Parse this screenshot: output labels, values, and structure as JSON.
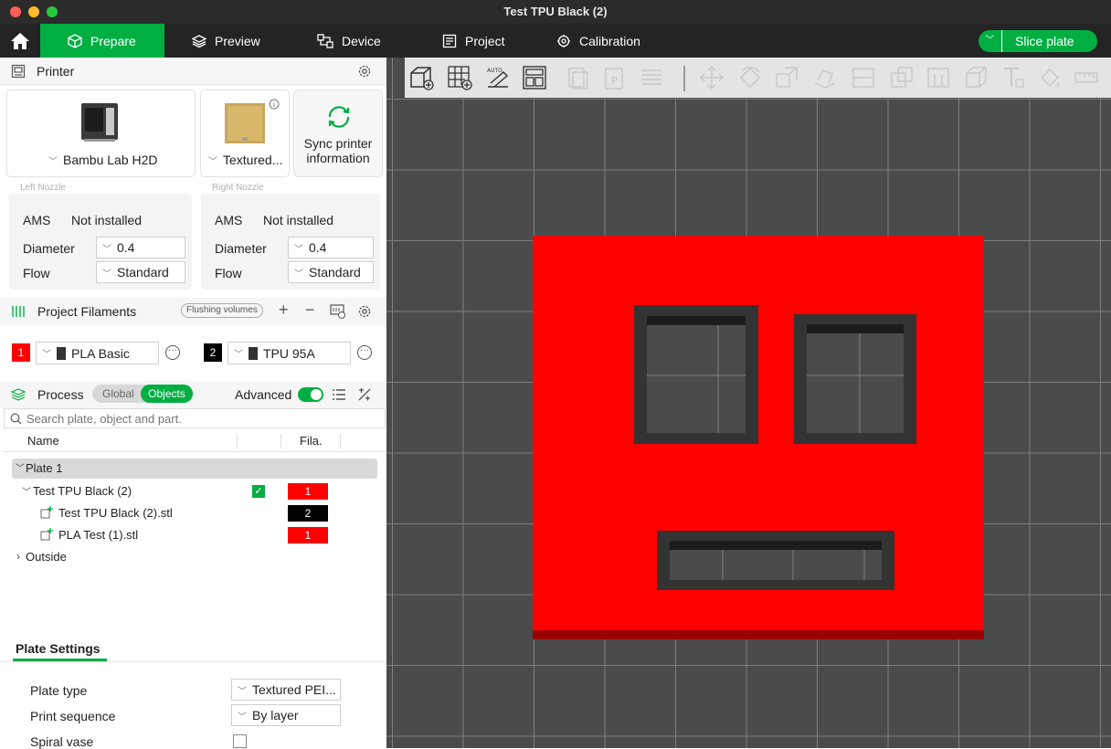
{
  "window": {
    "title": "Test TPU Black (2)"
  },
  "tabs": [
    {
      "label": "Prepare"
    },
    {
      "label": "Preview"
    },
    {
      "label": "Device"
    },
    {
      "label": "Project"
    },
    {
      "label": "Calibration"
    }
  ],
  "slice_button": {
    "label": "Slice plate"
  },
  "printer": {
    "section_title": "Printer",
    "model": "Bambu Lab H2D",
    "plate": "Textured...",
    "sync_label": "Sync printer information",
    "left_nozzle": {
      "title": "Left Nozzle",
      "ams_label": "AMS",
      "ams_value": "Not installed",
      "diameter_label": "Diameter",
      "diameter": "0.4",
      "flow_label": "Flow",
      "flow": "Standard"
    },
    "right_nozzle": {
      "title": "Right Nozzle",
      "ams_label": "AMS",
      "ams_value": "Not installed",
      "diameter_label": "Diameter",
      "diameter": "0.4",
      "flow_label": "Flow",
      "flow": "Standard"
    }
  },
  "filaments": {
    "section_title": "Project Filaments",
    "flushing_label": "Flushing volumes",
    "items": [
      {
        "index": "1",
        "name": "PLA Basic",
        "color": "#ff0000"
      },
      {
        "index": "2",
        "name": "TPU 95A",
        "color": "#000000"
      }
    ]
  },
  "process": {
    "section_title": "Process",
    "global_label": "Global",
    "objects_label": "Objects",
    "advanced_label": "Advanced",
    "advanced_on": true,
    "search_placeholder": "Search plate, object and part."
  },
  "object_list": {
    "col_name": "Name",
    "col_fila": "Fila.",
    "plate_label": "Plate 1",
    "object_label": "Test TPU Black (2)",
    "object_fila": "1",
    "parts": [
      {
        "label": "Test TPU Black (2).stl",
        "fila": "2"
      },
      {
        "label": "PLA Test (1).stl",
        "fila": "1"
      }
    ],
    "outside_label": "Outside"
  },
  "plate_settings": {
    "title": "Plate Settings",
    "plate_type_label": "Plate type",
    "plate_type_value": "Textured PEI...",
    "print_sequence_label": "Print sequence",
    "print_sequence_value": "By layer",
    "spiral_vase_label": "Spiral vase",
    "spiral_vase_checked": false
  },
  "colors": {
    "accent": "#00ae42",
    "model_red": "#ff0000",
    "model_dark": "#333333",
    "viewport_bg": "#4a4c4c"
  }
}
